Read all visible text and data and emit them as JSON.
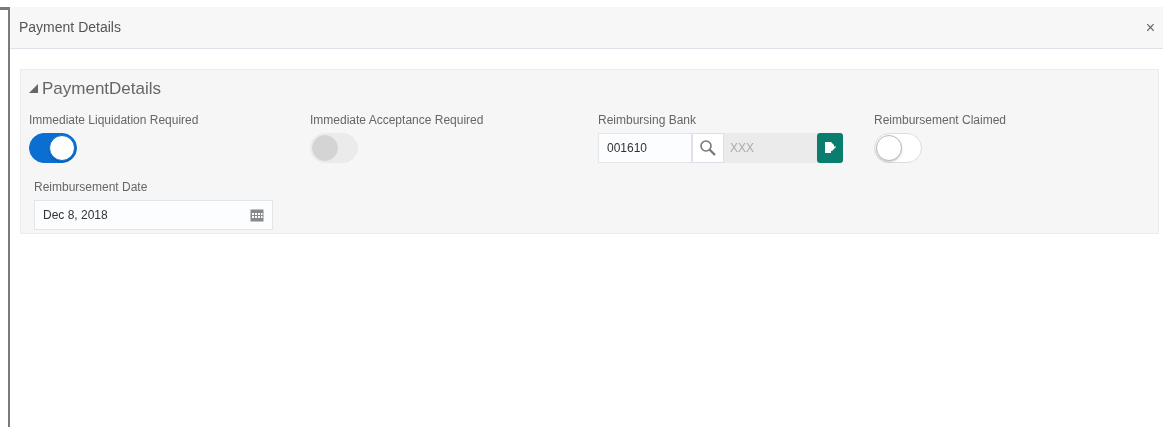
{
  "dialog": {
    "title": "Payment Details",
    "close": "×"
  },
  "section": {
    "title": "PaymentDetails",
    "expanded": true,
    "fields": [
      {
        "kind": "toggle",
        "label": "Immediate Liquidation Required",
        "on": true,
        "disabled": false
      },
      {
        "kind": "toggle",
        "label": "Immediate Acceptance Required",
        "on": false,
        "disabled": true
      },
      {
        "kind": "lookup",
        "label": "Reimbursing Bank",
        "value": "001610",
        "description_placeholder": "XXX"
      },
      {
        "kind": "toggle",
        "label": "Reimbursement Claimed",
        "on": false,
        "disabled": false
      },
      {
        "kind": "date",
        "label": "Reimbursement Date",
        "value": "Dec 8, 2018"
      }
    ]
  }
}
